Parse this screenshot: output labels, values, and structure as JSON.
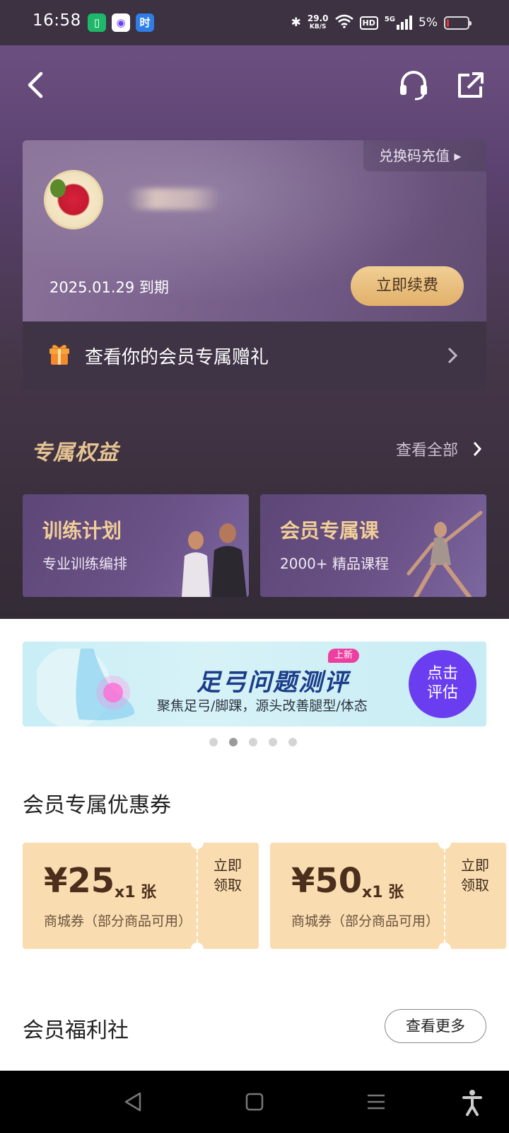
{
  "status_bar": {
    "time": "16:58",
    "speed_value": "29.0",
    "speed_unit": "KB/S",
    "hd_label": "HD",
    "network": "5G",
    "battery": "5%"
  },
  "icons": {
    "back": "back-arrow-icon",
    "customer_service": "headset-icon",
    "share": "share-icon",
    "gift": "gift-icon"
  },
  "member_card": {
    "redeem_label": "兑换码充值 ▸",
    "expiry": "2025.01.29 到期",
    "renew_label": "立即续费"
  },
  "gift_row": {
    "label": "查看你的会员专属赠礼"
  },
  "exclusive": {
    "title": "专属权益",
    "view_all": "查看全部",
    "cards": [
      {
        "title": "训练计划",
        "subtitle": "专业训练编排"
      },
      {
        "title": "会员专属课",
        "subtitle": "2000+ 精品课程"
      }
    ]
  },
  "banner": {
    "badge": "上新",
    "title": "足弓问题测评",
    "subtitle": "聚焦足弓/脚踝，源头改善腿型/体态",
    "cta_line1": "点击",
    "cta_line2": "评估",
    "page_count": 5,
    "active_page": 2
  },
  "coupons": {
    "title": "会员专属优惠券",
    "items": [
      {
        "amount": "¥25",
        "qty": "x1 张",
        "desc": "商城券（部分商品可用）",
        "claim": "立即领取"
      },
      {
        "amount": "¥50",
        "qty": "x1 张",
        "desc": "商城券（部分商品可用）",
        "claim": "立即领取"
      }
    ]
  },
  "welfare": {
    "title": "会员福利社",
    "more_label": "查看更多"
  },
  "colors": {
    "hero_top": "#6b4f80",
    "hero_bottom": "#332b36",
    "gold": "#e6c493",
    "renew_btn": "#e2b06b",
    "coupon_bg": "#f9dcaf",
    "banner_btn": "#6a3df0"
  }
}
